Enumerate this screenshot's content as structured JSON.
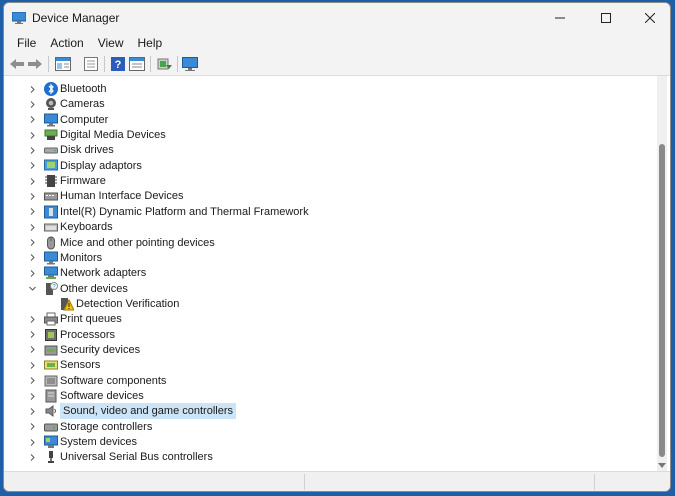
{
  "window": {
    "title": "Device Manager"
  },
  "menu": [
    "File",
    "Action",
    "View",
    "Help"
  ],
  "toolbar": [
    "back-icon",
    "forward-icon",
    "properties-icon",
    "device-list-icon",
    "help-icon",
    "view-icon",
    "update-driver-icon",
    "scan-hardware-icon"
  ],
  "tree": [
    {
      "label": "Bluetooth",
      "icon": "bluetooth-icon",
      "state": "collapsed",
      "level": 0
    },
    {
      "label": "Cameras",
      "icon": "camera-icon",
      "state": "collapsed",
      "level": 0
    },
    {
      "label": "Computer",
      "icon": "computer-icon",
      "state": "collapsed",
      "level": 0
    },
    {
      "label": "Digital Media Devices",
      "icon": "media-device-icon",
      "state": "collapsed",
      "level": 0
    },
    {
      "label": "Disk drives",
      "icon": "disk-icon",
      "state": "collapsed",
      "level": 0
    },
    {
      "label": "Display adaptors",
      "icon": "display-adapter-icon",
      "state": "collapsed",
      "level": 0
    },
    {
      "label": "Firmware",
      "icon": "firmware-icon",
      "state": "collapsed",
      "level": 0
    },
    {
      "label": "Human Interface Devices",
      "icon": "hid-icon",
      "state": "collapsed",
      "level": 0
    },
    {
      "label": "Intel(R) Dynamic Platform and Thermal Framework",
      "icon": "thermal-icon",
      "state": "collapsed",
      "level": 0
    },
    {
      "label": "Keyboards",
      "icon": "keyboard-icon",
      "state": "collapsed",
      "level": 0
    },
    {
      "label": "Mice and other pointing devices",
      "icon": "mouse-icon",
      "state": "collapsed",
      "level": 0
    },
    {
      "label": "Monitors",
      "icon": "monitor-icon",
      "state": "collapsed",
      "level": 0
    },
    {
      "label": "Network adapters",
      "icon": "network-icon",
      "state": "collapsed",
      "level": 0
    },
    {
      "label": "Other devices",
      "icon": "other-devices-icon",
      "state": "expanded",
      "level": 0
    },
    {
      "label": "Detection Verification",
      "icon": "warning-device-icon",
      "state": "leaf",
      "level": 1
    },
    {
      "label": "Print queues",
      "icon": "printer-icon",
      "state": "collapsed",
      "level": 0
    },
    {
      "label": "Processors",
      "icon": "processor-icon",
      "state": "collapsed",
      "level": 0
    },
    {
      "label": "Security devices",
      "icon": "security-icon",
      "state": "collapsed",
      "level": 0
    },
    {
      "label": "Sensors",
      "icon": "sensor-icon",
      "state": "collapsed",
      "level": 0
    },
    {
      "label": "Software components",
      "icon": "software-component-icon",
      "state": "collapsed",
      "level": 0
    },
    {
      "label": "Software devices",
      "icon": "software-device-icon",
      "state": "collapsed",
      "level": 0
    },
    {
      "label": "Sound, video and game controllers",
      "icon": "speaker-icon",
      "state": "collapsed",
      "level": 0,
      "selected": true
    },
    {
      "label": "Storage controllers",
      "icon": "storage-icon",
      "state": "collapsed",
      "level": 0
    },
    {
      "label": "System devices",
      "icon": "system-icon",
      "state": "collapsed",
      "level": 0
    },
    {
      "label": "Universal Serial Bus controllers",
      "icon": "usb-icon",
      "state": "collapsed",
      "level": 0
    }
  ],
  "colors": {
    "selection": "#cce4f7",
    "chrome": "#f3f3f3",
    "accent": "#0067c0"
  }
}
